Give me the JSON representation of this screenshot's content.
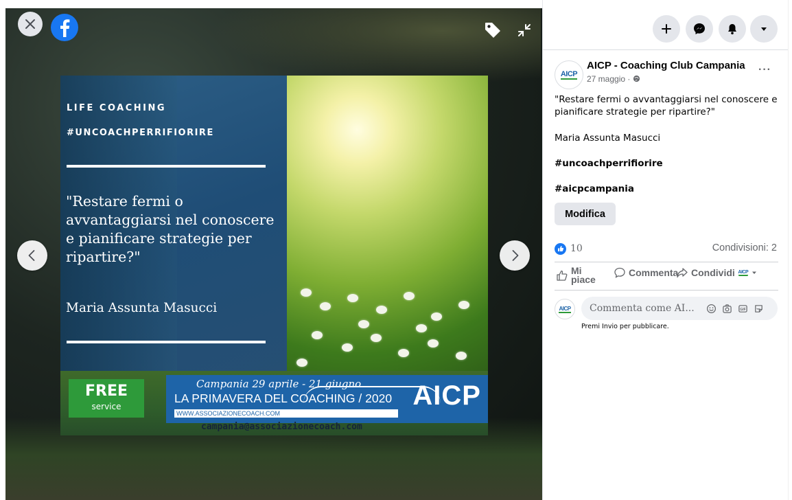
{
  "viewer": {
    "close_icon": "close-icon",
    "logo_icon": "facebook-logo-icon",
    "tag_icon": "tag-icon",
    "minimize_icon": "minimize-icon",
    "prev_icon": "chevron-left-icon",
    "next_icon": "chevron-right-icon"
  },
  "poster": {
    "label_life": "LIFE COACHING",
    "label_hashtag": "#UNCOACHPERRIFIORIRE",
    "quote": "\"Restare fermi o avvantaggiarsi nel conoscere e pianificare strategie per ripartire?\"",
    "author": "Maria Assunta Masucci",
    "free": "FREE",
    "service": "service",
    "banner_script": "Campania 29 aprile - 21 giugno",
    "banner_event": "LA PRIMAVERA DEL COACHING / 2020",
    "banner_site": "WWW.ASSOCIAZIONECOACH.COM",
    "brand": "AICP",
    "email": "campania@associazionecoach.com"
  },
  "topbar": {
    "plus_icon": "plus-icon",
    "messenger_icon": "messenger-icon",
    "bell_icon": "bell-icon",
    "caret_icon": "caret-down-icon"
  },
  "post": {
    "avatar_text": "AICP",
    "page_name": "AICP - Coaching Club Campania",
    "date": "27 maggio ·",
    "more": "···",
    "text_line1": "\"Restare fermi o avvantaggiarsi nel conoscere e",
    "text_line2": "pianificare strategie per ripartire?\"",
    "author": "Maria Assunta Masucci",
    "hashtag1": "#uncoachperrifiorire",
    "hashtag2": "#aicpcampania",
    "edit_label": "Modifica",
    "like_count": "10",
    "shares": "Condivisioni: 2",
    "like_line1": "Mi",
    "like_line2": "piace",
    "comment_label": "Commenta",
    "share_label": "Condividi",
    "comment_placeholder": "Commenta come AI...",
    "press_enter": "Premi Invio per pubblicare."
  },
  "colors": {
    "accent": "#1877f2",
    "text": "#050505",
    "muted": "#65676b",
    "banner": "#1e64a8",
    "free_badge": "#2e9a3a"
  }
}
